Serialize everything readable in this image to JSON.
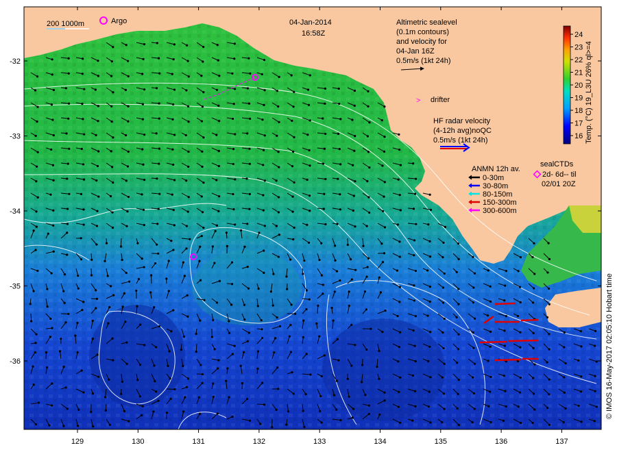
{
  "header": {
    "date": "04-Jan-2014",
    "time": "16:58Z"
  },
  "scale_legend": {
    "isobaths": "200  1000m",
    "argo": "Argo"
  },
  "altimetry": {
    "lines": [
      "Altimetric sealevel",
      "(0.1m contours)",
      "and velocity for",
      "04-Jan 16Z",
      "0.5m/s (1kt 24h)"
    ]
  },
  "drifter": {
    "label": "drifter"
  },
  "hf_radar": {
    "lines": [
      "HF radar velocity",
      "(4-12h avg)noQC",
      "0.5m/s (1kt 24h)"
    ]
  },
  "anmn": {
    "title": "ANMN 12h av.",
    "items": [
      {
        "label": "0-30m",
        "color": "#000000"
      },
      {
        "label": "30-80m",
        "color": "#0000ff"
      },
      {
        "label": "80-150m",
        "color": "#00e5e5"
      },
      {
        "label": "150-300m",
        "color": "#e00000"
      },
      {
        "label": "300-600m",
        "color": "#ff00ff"
      }
    ]
  },
  "sealctds": {
    "lines": [
      "sealCTDs",
      "2d- 6d-- til",
      "02/01 20Z"
    ]
  },
  "colorbar": {
    "title": "Temp. (°C) 19_L3U 26% ql>=4",
    "ticks": [
      "24",
      "23",
      "22",
      "21",
      "20",
      "19",
      "18",
      "17",
      "16"
    ]
  },
  "credit": "© IMOS 16-May-2017 02:05:10 Hobart time",
  "axes": {
    "x_ticks": [
      "129",
      "130",
      "131",
      "132",
      "133",
      "134",
      "135",
      "136",
      "137"
    ],
    "y_ticks": [
      "-32",
      "-33",
      "-34",
      "-35",
      "-36"
    ]
  },
  "colors": {
    "land": "#f9c8a0",
    "sst_warm": "#19b83a",
    "sst_cool": "#1450e0"
  }
}
